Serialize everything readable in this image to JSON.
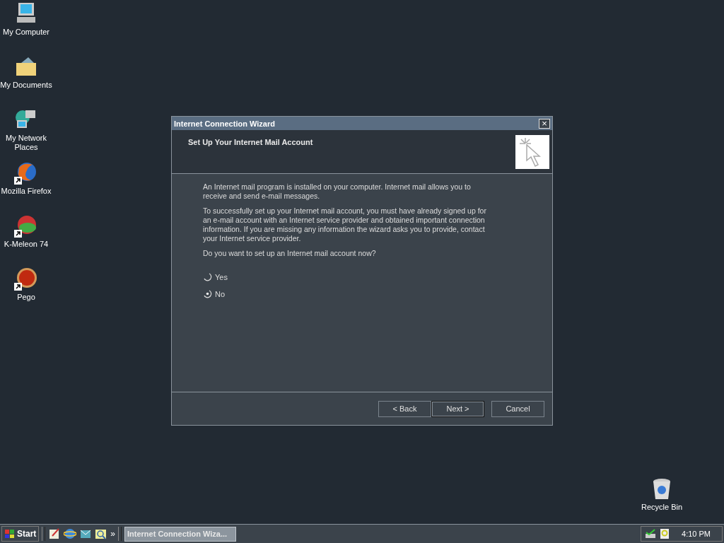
{
  "desktop_icons": [
    {
      "kind": "computer",
      "label": "My Computer",
      "shortcut": false
    },
    {
      "kind": "documents",
      "label": "My Documents",
      "shortcut": false
    },
    {
      "kind": "network",
      "label": "My Network Places",
      "shortcut": false
    },
    {
      "kind": "globe",
      "label": "Mozilla Firefox",
      "shortcut": true
    },
    {
      "kind": "chameleon",
      "label": "K-Meleon 74",
      "shortcut": true
    },
    {
      "kind": "ball",
      "label": "Pego",
      "shortcut": true
    }
  ],
  "recycle_bin": {
    "label": "Recycle Bin"
  },
  "window": {
    "title": "Internet Connection Wizard",
    "close": "×",
    "header": {
      "title": "Set Up Your Internet Mail Account"
    },
    "paragraphs": [
      "An Internet mail program is installed on your computer. Internet mail allows you to receive and send e-mail messages.",
      "To successfully set up your Internet mail account, you must have already signed up for an e-mail account with an Internet service provider and obtained important connection information. If you are missing any information the wizard asks you to provide, contact your Internet service provider.",
      "Do you want to set up an Internet mail account now?"
    ],
    "options": [
      {
        "label": "Yes",
        "selected": false
      },
      {
        "label": "No",
        "selected": true
      }
    ],
    "buttons": [
      {
        "label": "< Back",
        "default": false
      },
      {
        "label": "Next >",
        "default": true
      },
      {
        "label": "Cancel",
        "default": false
      }
    ]
  },
  "taskbar": {
    "start": "Start",
    "overflow": "»",
    "tasks": [
      {
        "label": "Internet Connection Wiza...",
        "selected": true
      }
    ],
    "clock": "4:10 PM"
  }
}
